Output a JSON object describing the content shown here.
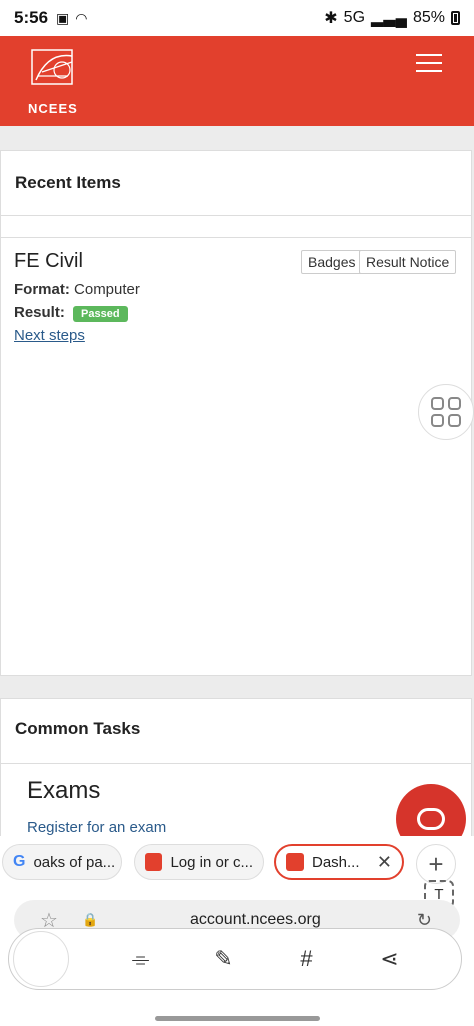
{
  "status_bar": {
    "time": "5:56",
    "network": "5G",
    "battery": "85%"
  },
  "header": {
    "logo_text": "NCEES",
    "brand_color": "#e2402d"
  },
  "recent_items": {
    "title": "Recent Items",
    "exam_name": "FE Civil",
    "badges_button": "Badges",
    "result_notice_button": "Result Notice",
    "format_label": "Format:",
    "format_value": "Computer",
    "result_label": "Result:",
    "result_value": "Passed",
    "next_steps_link": "Next steps"
  },
  "common_tasks": {
    "title": "Common Tasks",
    "exams_heading": "Exams",
    "register_link": "Register for an exam"
  },
  "browser": {
    "tabs": [
      {
        "label": "oaks of pa...",
        "icon": "google-icon"
      },
      {
        "label": "Log in or c...",
        "icon": "ncees-favicon"
      },
      {
        "label": "Dash...",
        "icon": "ncees-favicon",
        "active": true
      }
    ],
    "new_tab_icon": "+",
    "text_icon": "T",
    "url": "account.ncees.org",
    "toolbar_icons": [
      "scan-icon",
      "edit-screenshot-icon",
      "hashtag-icon",
      "share-icon"
    ]
  }
}
